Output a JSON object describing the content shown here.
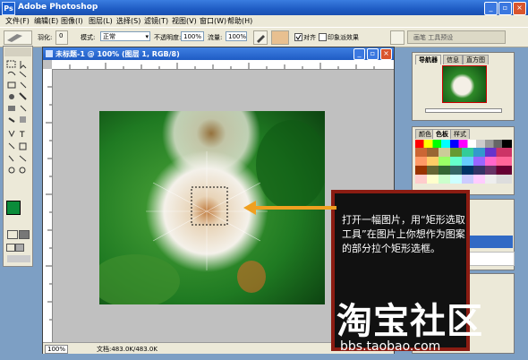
{
  "window": {
    "title": "Adobe Photoshop"
  },
  "menu": [
    "文件(F)",
    "编辑(E)",
    "图像(I)",
    "图层(L)",
    "选择(S)",
    "滤镜(T)",
    "视图(V)",
    "窗口(W)",
    "帮助(H)"
  ],
  "options": {
    "feather_label": "羽化:",
    "feather_value": "0",
    "mode_label": "模式:",
    "mode_value": "正常",
    "opacity_label": "不透明度:",
    "opacity_value": "100%",
    "flow_label": "流量:",
    "flow_value": "100%",
    "align_label": "对齐",
    "impression_label": "印象派效果",
    "brushes_tab": "画笔  工具预设"
  },
  "document": {
    "title": "未标题-1 @ 100% (图层 1, RGB/8)",
    "zoom": "100%",
    "doc_size": "文档:483.0K/483.0K"
  },
  "panels": {
    "navigator_tabs": [
      "导航器",
      "信息",
      "直方图"
    ],
    "color_tabs": [
      "颜色",
      "色板",
      "样式"
    ]
  },
  "note": {
    "text": "打开一幅图片，用“矩形选取工具”在图片上你想作为图案的部分拉个矩形选框。",
    "brand": "淘宝社区",
    "url": "bbs.taobao.com"
  },
  "colors": {
    "foreground": "#0b8c3a",
    "background": "#ffffff"
  }
}
